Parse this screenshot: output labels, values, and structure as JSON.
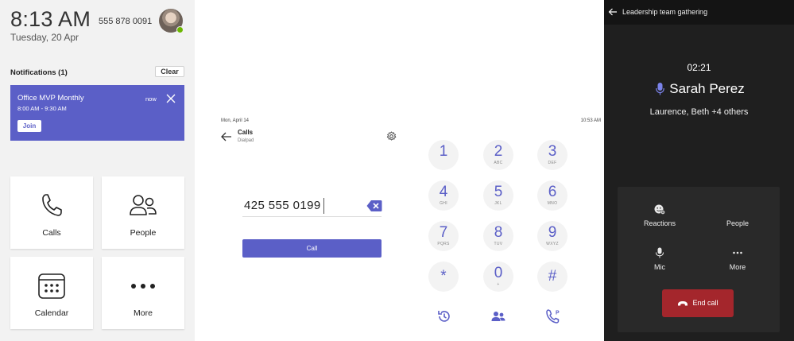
{
  "home": {
    "time": "8:13 AM",
    "date": "Tuesday, 20 Apr",
    "phone_number": "555 878 0091",
    "notifications_title": "Notifications (1)",
    "clear_label": "Clear",
    "notification": {
      "title": "Office MVP Monthly",
      "time_range": "8:00 AM - 9:30 AM",
      "age": "now",
      "join_label": "Join"
    },
    "tiles": [
      {
        "label": "Calls",
        "icon": "phone-icon"
      },
      {
        "label": "People",
        "icon": "people-icon"
      },
      {
        "label": "Calendar",
        "icon": "calendar-icon"
      },
      {
        "label": "More",
        "icon": "more-icon"
      }
    ]
  },
  "dialpad": {
    "date": "Mon, April 14",
    "clock": "10:53 AM",
    "title": "Calls",
    "subtitle": "Dialpad",
    "entered_number": "425 555 0199",
    "call_label": "Call",
    "keys": [
      {
        "digit": "1",
        "letters": ""
      },
      {
        "digit": "2",
        "letters": "ABC"
      },
      {
        "digit": "3",
        "letters": "DEF"
      },
      {
        "digit": "4",
        "letters": "GHI"
      },
      {
        "digit": "5",
        "letters": "JKL"
      },
      {
        "digit": "6",
        "letters": "MNO"
      },
      {
        "digit": "7",
        "letters": "PQRS"
      },
      {
        "digit": "8",
        "letters": "TUV"
      },
      {
        "digit": "9",
        "letters": "WXYZ"
      },
      {
        "digit": "*",
        "letters": ""
      },
      {
        "digit": "0",
        "letters": "+"
      },
      {
        "digit": "#",
        "letters": ""
      }
    ],
    "bottom_icons": [
      "history-icon",
      "contacts-icon",
      "voicemail-icon"
    ]
  },
  "call": {
    "meeting_title": "Leadership team gathering",
    "duration": "02:21",
    "speaker": "Sarah Perez",
    "participants": "Laurence, Beth +4 others",
    "controls": {
      "reactions": "Reactions",
      "people": "People",
      "mic": "Mic",
      "more": "More",
      "end_call": "End call"
    }
  },
  "colors": {
    "accent": "#5b5fc7",
    "end_call": "#a4262c",
    "presence": "#6bb700"
  }
}
